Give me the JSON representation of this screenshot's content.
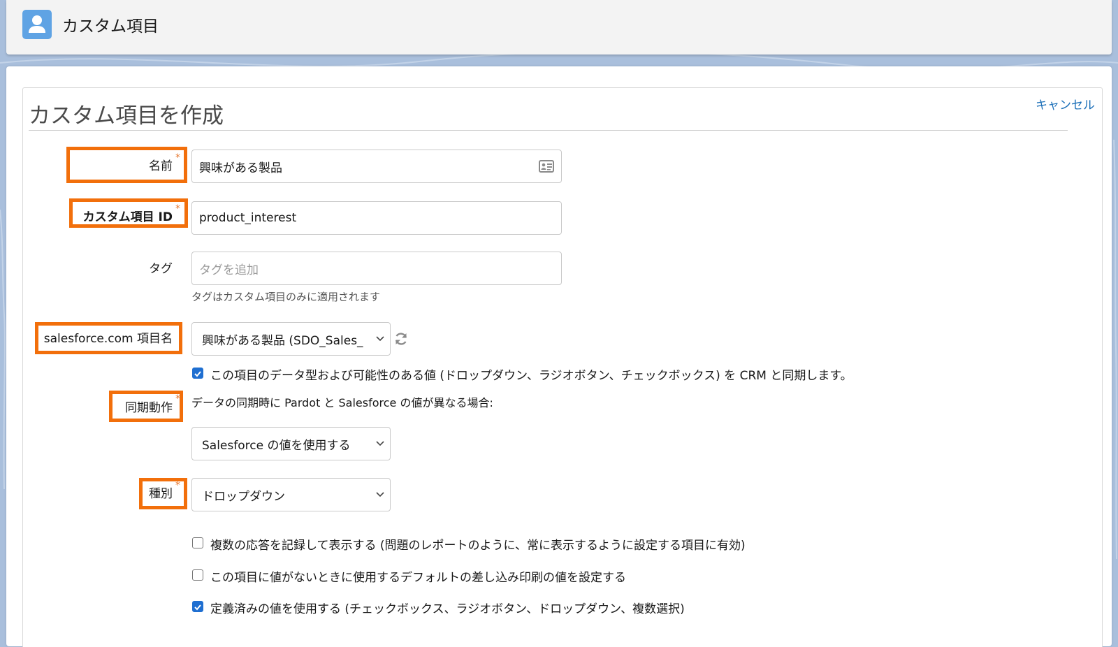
{
  "header": {
    "title": "カスタム項目",
    "icon": "user-icon"
  },
  "page": {
    "title": "カスタム項目を作成",
    "cancel_label": "キャンセル"
  },
  "form": {
    "name": {
      "label": "名前",
      "required_mark": "*",
      "value": "興味がある製品",
      "icon": "contact-card-icon"
    },
    "custom_field_id": {
      "label": "カスタム項目 ID",
      "required_mark": "*",
      "value": "product_interest"
    },
    "tags": {
      "label": "タグ",
      "placeholder": "タグを追加",
      "help": "タグはカスタム項目のみに適用されます"
    },
    "salesforce_field": {
      "label": "salesforce.com 項目名",
      "selected": "興味がある製品 (SDO_Sales_",
      "refresh_icon": "refresh-icon"
    },
    "sync_crm": {
      "checked": true,
      "label": "この項目のデータ型および可能性のある値 (ドロップダウン、ラジオボタン、チェックボックス) を CRM と同期します。"
    },
    "sync_behavior": {
      "label": "同期動作",
      "required_mark": "*",
      "description": "データの同期時に Pardot と Salesforce の値が異なる場合:",
      "selected": "Salesforce の値を使用する"
    },
    "type": {
      "label": "種別",
      "required_mark": "*",
      "selected": "ドロップダウン"
    },
    "options": [
      {
        "checked": false,
        "label": "複数の応答を記録して表示する (問題のレポートのように、常に表示するように設定する項目に有効)"
      },
      {
        "checked": false,
        "label": "この項目に値がないときに使用するデフォルトの差し込み印刷の値を設定する"
      },
      {
        "checked": true,
        "label": "定義済みの値を使用する (チェックボックス、ラジオボタン、ドロップダウン、複数選択)"
      }
    ]
  },
  "colors": {
    "highlight": "#f26f0b",
    "link": "#1b6fb8",
    "checkbox": "#1f6fd1",
    "header_icon": "#5fa3e4",
    "required": "#e6772e"
  }
}
